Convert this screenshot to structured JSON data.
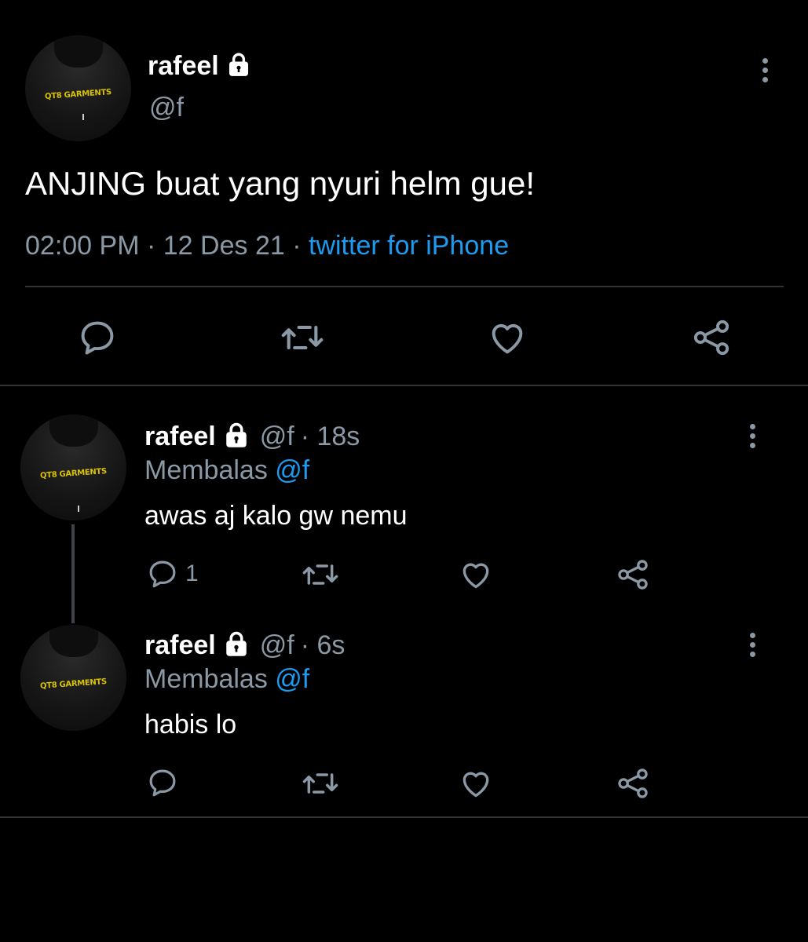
{
  "tweet": {
    "display_name": "rafeel",
    "handle": "@f",
    "text": "ANJING buat yang nyuri helm gue!",
    "time": "02:00 PM",
    "separator": "·",
    "date": "12 Des 21",
    "client": "twitter for iPhone"
  },
  "avatar_shirt_text": "QT8 GARMENTS",
  "replies": [
    {
      "display_name": "rafeel",
      "handle": "@f",
      "age": "· 18s",
      "replying_label": "Membalas",
      "replying_to": "@f",
      "text": "awas aj kalo gw nemu",
      "reply_count": "1"
    },
    {
      "display_name": "rafeel",
      "handle": "@f",
      "age": "· 6s",
      "replying_label": "Membalas",
      "replying_to": "@f",
      "text": "habis lo",
      "reply_count": ""
    }
  ],
  "icons": {
    "reply": "reply-icon",
    "retweet": "retweet-icon",
    "like": "heart-icon",
    "share": "share-icon",
    "more": "more-options-icon",
    "lock": "lock-icon"
  },
  "colors": {
    "background": "#000000",
    "text": "#ffffff",
    "muted": "#8b98a5",
    "link": "#1d9bf0",
    "divider": "#2f3336"
  }
}
